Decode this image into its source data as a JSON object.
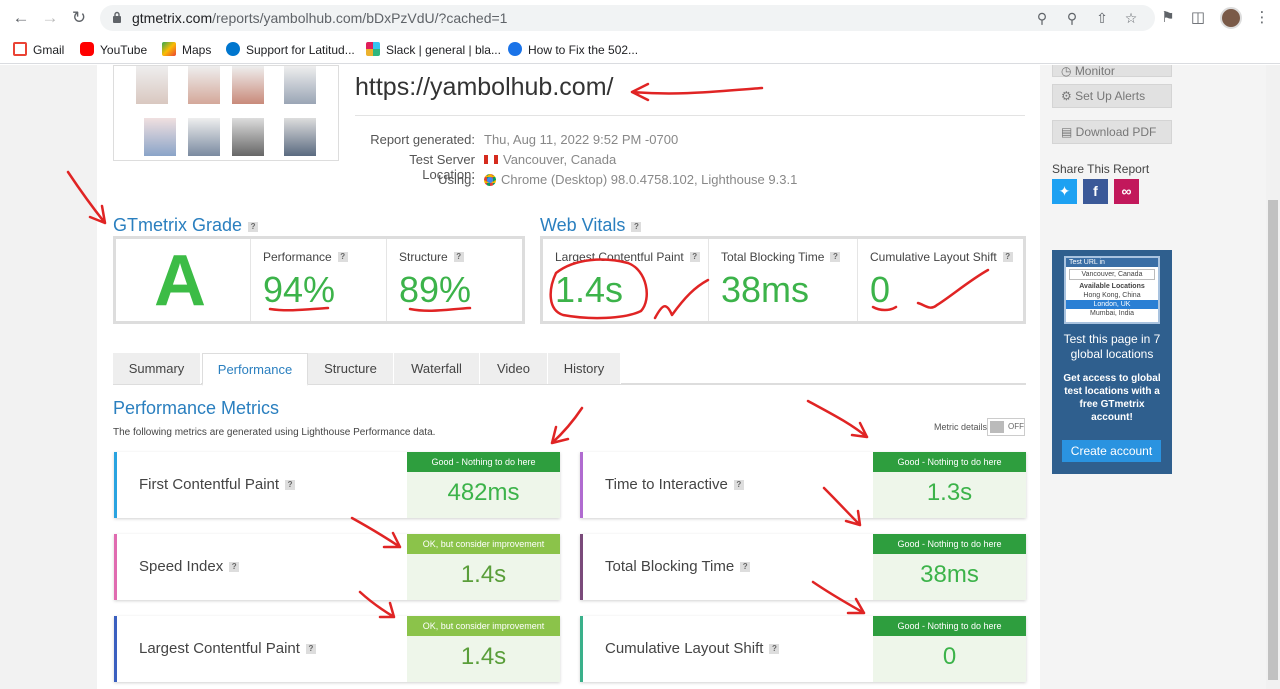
{
  "browser": {
    "url_host": "gtmetrix.com",
    "url_path": "/reports/yambolhub.com/bDxPzVdU/?cached=1",
    "bookmarks": [
      {
        "label": "Gmail",
        "color": "#ea4335"
      },
      {
        "label": "YouTube",
        "color": "#ff0000"
      },
      {
        "label": "Maps",
        "color": "#34a853"
      },
      {
        "label": "Support for Latitud...",
        "color": "#0076ce"
      },
      {
        "label": "Slack | general | bla...",
        "color": "#611f69"
      },
      {
        "label": "How to Fix the 502...",
        "color": "#1a73e8"
      }
    ]
  },
  "report": {
    "site_url": "https://yambolhub.com/",
    "meta": [
      {
        "label": "Report generated:",
        "value": "Thu, Aug 11, 2022 9:52 PM -0700"
      },
      {
        "label": "Test Server Location:",
        "value": "Vancouver, Canada"
      },
      {
        "label": "Using:",
        "value": "Chrome (Desktop) 98.0.4758.102, Lighthouse 9.3.1"
      }
    ]
  },
  "grade": {
    "title": "GTmetrix Grade",
    "letter": "A",
    "performance_label": "Performance",
    "performance_value": "94%",
    "structure_label": "Structure",
    "structure_value": "89%"
  },
  "vitals": {
    "title": "Web Vitals",
    "items": [
      {
        "label": "Largest Contentful Paint",
        "value": "1.4s"
      },
      {
        "label": "Total Blocking Time",
        "value": "38ms"
      },
      {
        "label": "Cumulative Layout Shift",
        "value": "0"
      }
    ]
  },
  "tabs": [
    "Summary",
    "Performance",
    "Structure",
    "Waterfall",
    "Video",
    "History"
  ],
  "performance_metrics": {
    "title": "Performance Metrics",
    "description": "The following metrics are generated using Lighthouse Performance data.",
    "metric_details_label": "Metric details",
    "toggle_label": "OFF",
    "cards": [
      {
        "label": "First Contentful Paint",
        "badge": "Good - Nothing to do here",
        "value": "482ms",
        "bar_color": "#29a3e0"
      },
      {
        "label": "Time to Interactive",
        "badge": "Good - Nothing to do here",
        "value": "1.3s",
        "bar_color": "#b06bd0"
      },
      {
        "label": "Speed Index",
        "badge": "OK, but consider improvement",
        "value": "1.4s",
        "bar_color": "#e06bb0"
      },
      {
        "label": "Total Blocking Time",
        "badge": "Good - Nothing to do here",
        "value": "38ms",
        "bar_color": "#7a4a7a"
      },
      {
        "label": "Largest Contentful Paint",
        "badge": "OK, but consider improvement",
        "value": "1.4s",
        "bar_color": "#3a5fbf"
      },
      {
        "label": "Cumulative Layout Shift",
        "badge": "Good - Nothing to do here",
        "value": "0",
        "bar_color": "#3ab08a"
      }
    ]
  },
  "sidebar": {
    "monitor": "Monitor",
    "alerts": "Set Up Alerts",
    "pdf": "Download PDF",
    "share_label": "Share This Report",
    "promo": {
      "mini_header": "Test URL in",
      "mini_current": "Vancouver, Canada",
      "mini_available": "Available Locations",
      "mini_locations": [
        "Hong Kong, China",
        "London, UK",
        "Mumbai, India"
      ],
      "headline": "Test this page in 7 global locations",
      "body": "Get access to global test locations with a free GTmetrix account!",
      "cta": "Create account"
    }
  }
}
